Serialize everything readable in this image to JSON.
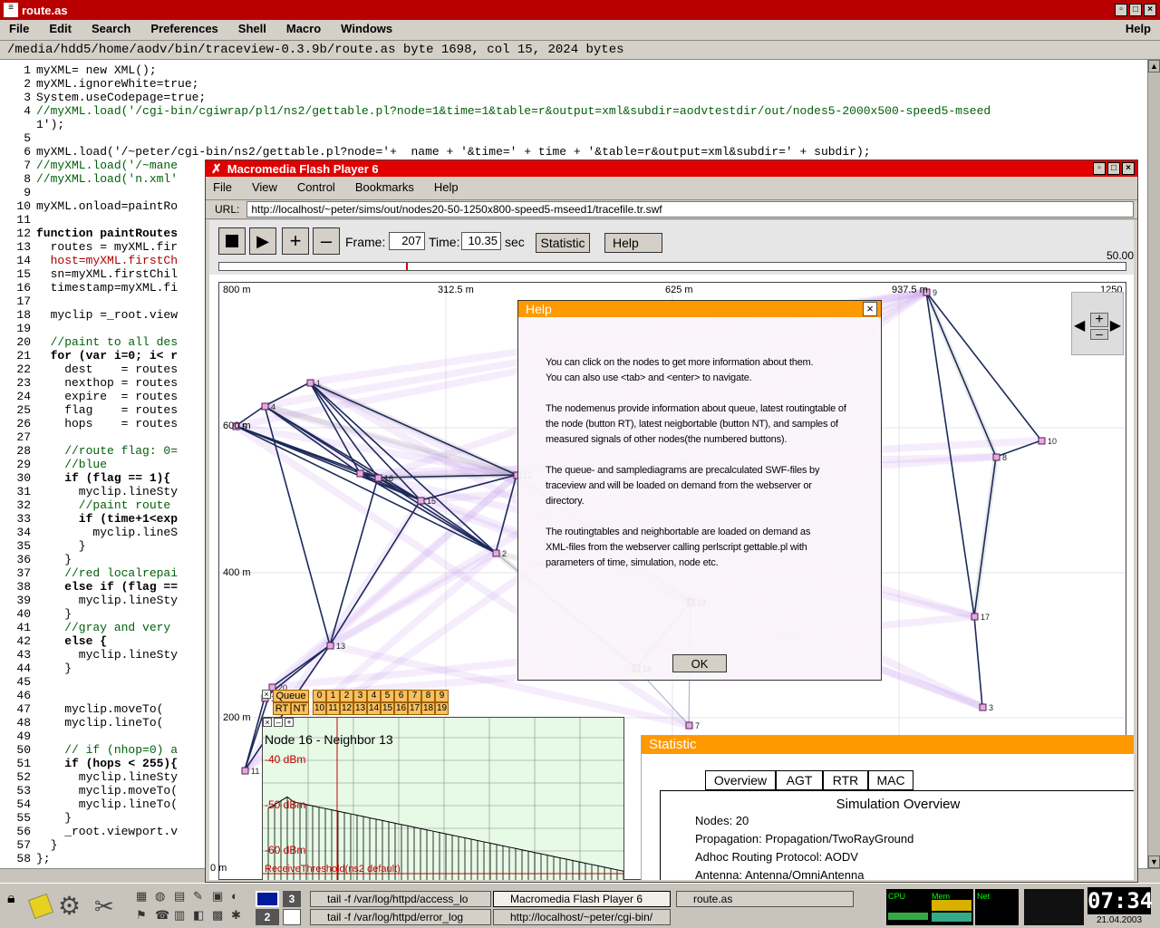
{
  "editor": {
    "title": "route.as",
    "menu": [
      "File",
      "Edit",
      "Search",
      "Preferences",
      "Shell",
      "Macro",
      "Windows"
    ],
    "menu_help": "Help",
    "status": "/media/hdd5/home/aodv/bin/traceview-0.3.9b/route.as byte 1698, col 15, 2024 bytes",
    "lines": [
      {
        "n": "1",
        "t": "myXML= new XML();"
      },
      {
        "n": "2",
        "t": "myXML.ignoreWhite=true;"
      },
      {
        "n": "3",
        "t": "System.useCodepage=true;"
      },
      {
        "n": "4",
        "t": "//myXML.load('/cgi-bin/cgiwrap/pl1/ns2/gettable.pl?node=1&time=1&table=r&output=xml&subdir=aodvtestdir/out/nodes5-2000x500-speed5-mseed"
      },
      {
        "n": "",
        "t": "1');"
      },
      {
        "n": "5",
        "t": ""
      },
      {
        "n": "6",
        "t": "myXML.load('/~peter/cgi-bin/ns2/gettable.pl?node='+  name + '&time=' + time + '&table=r&output=xml&subdir=' + subdir);"
      },
      {
        "n": "7",
        "t": "//myXML.load('/~mane"
      },
      {
        "n": "8",
        "t": "//myXML.load('n.xml'"
      },
      {
        "n": "9",
        "t": ""
      },
      {
        "n": "10",
        "t": "myXML.onload=paintRo"
      },
      {
        "n": "11",
        "t": ""
      },
      {
        "n": "12",
        "t": "function paintRoutes"
      },
      {
        "n": "13",
        "t": "  routes = myXML.fir"
      },
      {
        "n": "14",
        "t": "  host=myXML.firstCh"
      },
      {
        "n": "15",
        "t": "  sn=myXML.firstChil"
      },
      {
        "n": "16",
        "t": "  timestamp=myXML.fi"
      },
      {
        "n": "17",
        "t": ""
      },
      {
        "n": "18",
        "t": "  myclip =_root.view"
      },
      {
        "n": "19",
        "t": ""
      },
      {
        "n": "20",
        "t": "  //paint to all des"
      },
      {
        "n": "21",
        "t": "  for (var i=0; i< r"
      },
      {
        "n": "22",
        "t": "    dest    = routes"
      },
      {
        "n": "23",
        "t": "    nexthop = routes"
      },
      {
        "n": "24",
        "t": "    expire  = routes"
      },
      {
        "n": "25",
        "t": "    flag    = routes"
      },
      {
        "n": "26",
        "t": "    hops    = routes"
      },
      {
        "n": "27",
        "t": ""
      },
      {
        "n": "28",
        "t": "    //route flag: 0="
      },
      {
        "n": "29",
        "t": "    //blue"
      },
      {
        "n": "30",
        "t": "    if (flag == 1){"
      },
      {
        "n": "31",
        "t": "      myclip.lineSty"
      },
      {
        "n": "32",
        "t": "      //paint route"
      },
      {
        "n": "33",
        "t": "      if (time+1<exp"
      },
      {
        "n": "34",
        "t": "        myclip.lineS"
      },
      {
        "n": "35",
        "t": "      }"
      },
      {
        "n": "36",
        "t": "    }"
      },
      {
        "n": "37",
        "t": "    //red localrepai"
      },
      {
        "n": "38",
        "t": "    else if (flag =="
      },
      {
        "n": "39",
        "t": "      myclip.lineSty"
      },
      {
        "n": "40",
        "t": "    }"
      },
      {
        "n": "41",
        "t": "    //gray and very"
      },
      {
        "n": "42",
        "t": "    else {"
      },
      {
        "n": "43",
        "t": "      myclip.lineSty"
      },
      {
        "n": "44",
        "t": "    }"
      },
      {
        "n": "45",
        "t": ""
      },
      {
        "n": "46",
        "t": ""
      },
      {
        "n": "47",
        "t": "    myclip.moveTo( "
      },
      {
        "n": "48",
        "t": "    myclip.lineTo( "
      },
      {
        "n": "49",
        "t": ""
      },
      {
        "n": "50",
        "t": "    // if (nhop=0) a"
      },
      {
        "n": "51",
        "t": "    if (hops < 255){"
      },
      {
        "n": "52",
        "t": "      myclip.lineSty"
      },
      {
        "n": "53",
        "t": "      myclip.moveTo("
      },
      {
        "n": "54",
        "t": "      myclip.lineTo("
      },
      {
        "n": "55",
        "t": "    }"
      },
      {
        "n": "56",
        "t": "    _root.viewport.v"
      },
      {
        "n": "57",
        "t": "  }"
      },
      {
        "n": "58",
        "t": "};"
      }
    ]
  },
  "flash": {
    "title": "Macromedia Flash Player 6",
    "menu": [
      "File",
      "View",
      "Control",
      "Bookmarks",
      "Help"
    ],
    "url_label": "URL:",
    "url": "http://localhost/~peter/sims/out/nodes20-50-1250x800-speed5-mseed1/tracefile.tr.swf",
    "frame_label": "Frame:",
    "frame": "207",
    "time_label": "Time:",
    "time": "10.35",
    "time_unit": "sec",
    "statistic_btn": "Statistic",
    "help_btn": "Help",
    "slider_max": "50.00",
    "axis": {
      "x0": "800 m",
      "x1": "312.5 m",
      "x2": "625 m",
      "x3": "937.5 m",
      "x4": "1250 m",
      "y400": "400 m",
      "y200": "200 m",
      "y0": "0 m",
      "y600": "600 m"
    }
  },
  "help": {
    "title": "Help",
    "paragraphs": [
      [
        "You can click on the nodes to get more information about them.",
        "You can also use <tab> and <enter> to navigate."
      ],
      [
        "The nodemenus provide information about queue, latest routingtable of",
        "the node (button RT), latest neigbortable (button NT), and samples of",
        "measured signals of other nodes(the numbered buttons)."
      ],
      [
        "The queue- and samplediagrams are precalculated SWF-files by",
        "traceview and will be loaded on demand from the webserver or",
        "directory."
      ],
      [
        "The routingtables and neighbortable are loaded on demand as",
        "XML-files from the webserver calling perlscript gettable.pl with",
        "parameters of time, simulation, node etc."
      ]
    ],
    "ok": "OK"
  },
  "nodemenu": {
    "queue": "Queue",
    "rt": "RT",
    "nt": "NT",
    "row1": [
      "0",
      "1",
      "2",
      "3",
      "4",
      "5",
      "6",
      "7",
      "8",
      "9"
    ],
    "row2": [
      "10",
      "11",
      "12",
      "13",
      "14",
      "15",
      "16",
      "17",
      "18",
      "19"
    ]
  },
  "signal": {
    "title": "Node 16 - Neighbor 13",
    "l40": "-40 dBm",
    "l50": "-50 dBm",
    "l60": "-60 dBm",
    "threshold": "ReceiveThreshold(ns2 default)"
  },
  "statistic": {
    "title": "Statistic",
    "tabs": [
      "Overview",
      "AGT",
      "RTR",
      "MAC"
    ],
    "heading": "Simulation Overview",
    "rows": [
      "Nodes: 20",
      "Propagation: Propagation/TwoRayGround",
      "Adhoc Routing Protocol: AODV",
      "Antenna: Antenna/OmniAntenna"
    ]
  },
  "taskbar": {
    "desk1": "3",
    "desk2": "2",
    "tasks": [
      "tail -f /var/log/httpd/access_lo",
      "Macromedia Flash Player 6",
      "route.as",
      "tail -f /var/log/httpd/error_log",
      "http://localhost/~peter/cgi-bin/"
    ],
    "mon": [
      "CPU",
      "Mem",
      "Net"
    ],
    "clock": "07:34",
    "date": "21.04.2003"
  }
}
